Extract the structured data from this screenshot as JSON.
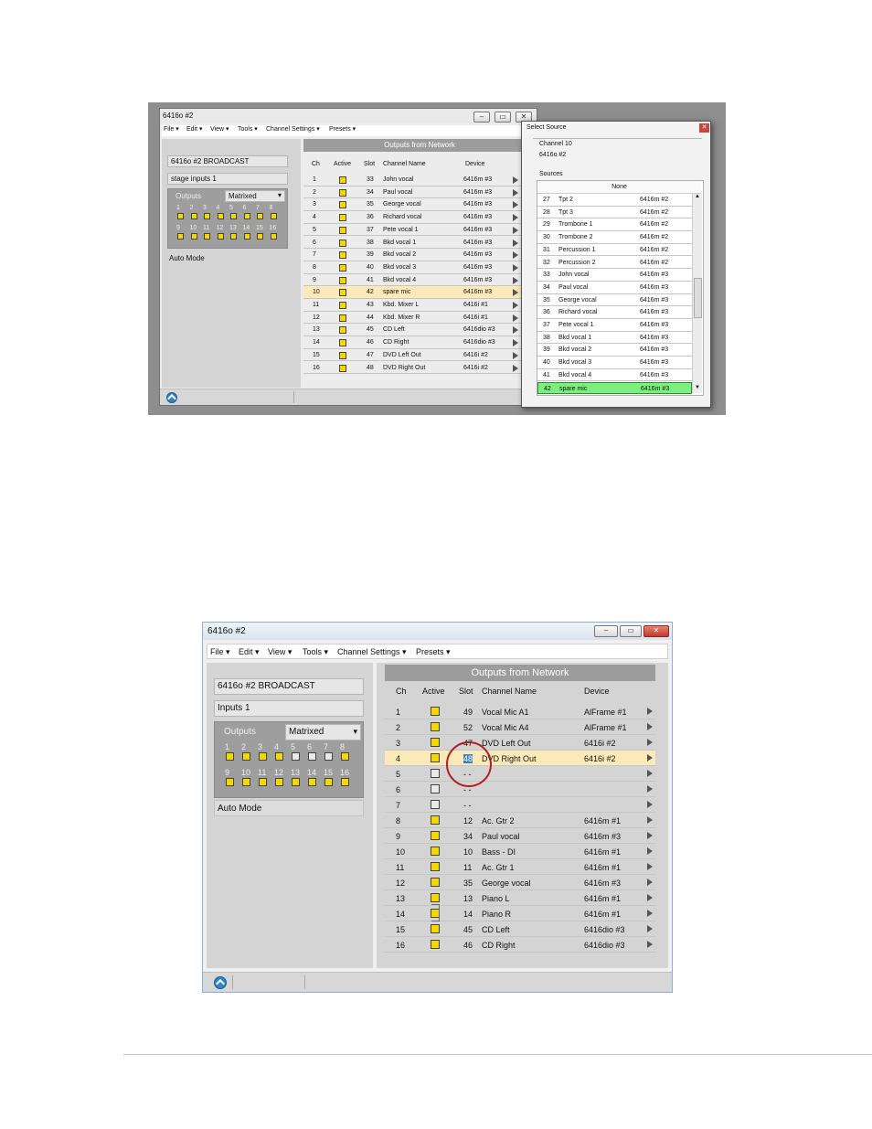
{
  "top": {
    "window_title": "6416o #2",
    "menu": [
      "File ▾",
      "Edit ▾",
      "View ▾",
      "Tools ▾",
      "Channel Settings ▾",
      "Presets ▾"
    ],
    "device_name": "6416o #2 BROADCAST",
    "inputs_name": "stage inputs 1",
    "outputs_label": "Outputs",
    "mode_select": "Matrixed",
    "grid_row1": [
      "1",
      "2",
      "3",
      "4",
      "5",
      "6",
      "7",
      "8"
    ],
    "grid_row2": [
      "9",
      "10",
      "11",
      "12",
      "13",
      "14",
      "15",
      "16"
    ],
    "grid_on1": [
      true,
      true,
      true,
      true,
      true,
      true,
      true,
      true
    ],
    "grid_on2": [
      true,
      true,
      true,
      true,
      true,
      true,
      true,
      true
    ],
    "auto_mode": "Auto Mode",
    "table_title": "Outputs from Network",
    "headers": {
      "ch": "Ch",
      "active": "Active",
      "slot": "Slot",
      "name": "Channel Name",
      "device": "Device"
    },
    "rows": [
      {
        "ch": "1",
        "slot": "33",
        "name": "John vocal",
        "device": "6416m #3"
      },
      {
        "ch": "2",
        "slot": "34",
        "name": "Paul vocal",
        "device": "6416m #3"
      },
      {
        "ch": "3",
        "slot": "35",
        "name": "George vocal",
        "device": "6416m #3"
      },
      {
        "ch": "4",
        "slot": "36",
        "name": "Richard vocal",
        "device": "6416m #3"
      },
      {
        "ch": "5",
        "slot": "37",
        "name": "Pete vocal 1",
        "device": "6416m #3"
      },
      {
        "ch": "6",
        "slot": "38",
        "name": "Bkd vocal 1",
        "device": "6416m #3"
      },
      {
        "ch": "7",
        "slot": "39",
        "name": "Bkd vocal 2",
        "device": "6416m #3"
      },
      {
        "ch": "8",
        "slot": "40",
        "name": "Bkd vocal 3",
        "device": "6416m #3"
      },
      {
        "ch": "9",
        "slot": "41",
        "name": "Bkd vocal 4",
        "device": "6416m #3"
      },
      {
        "ch": "10",
        "slot": "42",
        "name": "spare mic",
        "device": "6416m #3"
      },
      {
        "ch": "11",
        "slot": "43",
        "name": "Kbd. Mixer L",
        "device": "6416i #1"
      },
      {
        "ch": "12",
        "slot": "44",
        "name": "Kbd. Mixer R",
        "device": "6416i #1"
      },
      {
        "ch": "13",
        "slot": "45",
        "name": "CD Left",
        "device": "6416dio #3"
      },
      {
        "ch": "14",
        "slot": "46",
        "name": "CD Right",
        "device": "6416dio #3"
      },
      {
        "ch": "15",
        "slot": "47",
        "name": "DVD Left Out",
        "device": "6416i #2"
      },
      {
        "ch": "16",
        "slot": "48",
        "name": "DVD Right Out",
        "device": "6416i #2"
      }
    ],
    "popup": {
      "title": "Select Source",
      "channel_label": "Channel  10",
      "channel_device": "6416o #2",
      "sources_label": "Sources",
      "none_label": "None",
      "sources": [
        {
          "slot": "27",
          "name": "Tpt 2",
          "device": "6416m #2"
        },
        {
          "slot": "28",
          "name": "Tpt 3",
          "device": "6416m #2"
        },
        {
          "slot": "29",
          "name": "Trombone 1",
          "device": "6416m #2"
        },
        {
          "slot": "30",
          "name": "Trombone 2",
          "device": "6416m #2"
        },
        {
          "slot": "31",
          "name": "Percussion 1",
          "device": "6416m #2"
        },
        {
          "slot": "32",
          "name": "Percussion 2",
          "device": "6416m #2"
        },
        {
          "slot": "33",
          "name": "John vocal",
          "device": "6416m #3"
        },
        {
          "slot": "34",
          "name": "Paul vocal",
          "device": "6416m #3"
        },
        {
          "slot": "35",
          "name": "George vocal",
          "device": "6416m #3"
        },
        {
          "slot": "36",
          "name": "Richard vocal",
          "device": "6416m #3"
        },
        {
          "slot": "37",
          "name": "Pete vocal 1",
          "device": "6416m #3"
        },
        {
          "slot": "38",
          "name": "Bkd vocal 1",
          "device": "6416m #3"
        },
        {
          "slot": "39",
          "name": "Bkd vocal 2",
          "device": "6416m #3"
        },
        {
          "slot": "40",
          "name": "Bkd vocal 3",
          "device": "6416m #3"
        },
        {
          "slot": "41",
          "name": "Bkd vocal 4",
          "device": "6416m #3"
        },
        {
          "slot": "42",
          "name": "spare mic",
          "device": "6416m #3"
        }
      ]
    }
  },
  "bottom": {
    "window_title": "6416o #2",
    "menu": [
      "File ▾",
      "Edit ▾",
      "View ▾",
      "Tools ▾",
      "Channel Settings ▾",
      "Presets ▾"
    ],
    "device_name": "6416o #2 BROADCAST",
    "inputs_name": "Inputs 1",
    "outputs_label": "Outputs",
    "mode_select": "Matrixed",
    "grid_row1": [
      "1",
      "2",
      "3",
      "4",
      "5",
      "6",
      "7",
      "8"
    ],
    "grid_row2": [
      "9",
      "10",
      "11",
      "12",
      "13",
      "14",
      "15",
      "16"
    ],
    "grid_on1": [
      true,
      true,
      true,
      true,
      false,
      false,
      false,
      true
    ],
    "grid_on2": [
      true,
      true,
      true,
      true,
      true,
      true,
      true,
      true
    ],
    "auto_mode": "Auto Mode",
    "table_title": "Outputs from Network",
    "headers": {
      "ch": "Ch",
      "active": "Active",
      "slot": "Slot",
      "name": "Channel Name",
      "device": "Device"
    },
    "rows": [
      {
        "ch": "1",
        "slot": "49",
        "name": "Vocal Mic A1",
        "device": "AlFrame #1",
        "on": true
      },
      {
        "ch": "2",
        "slot": "52",
        "name": "Vocal Mic A4",
        "device": "AlFrame #1",
        "on": true
      },
      {
        "ch": "3",
        "slot": "47",
        "name": "DVD Left Out",
        "device": "6416i #2",
        "on": true
      },
      {
        "ch": "4",
        "slot": "48",
        "name": "DVD Right Out",
        "device": "6416i #2",
        "on": true
      },
      {
        "ch": "5",
        "slot": "- -",
        "name": "",
        "device": "",
        "on": false
      },
      {
        "ch": "6",
        "slot": "- -",
        "name": "",
        "device": "",
        "on": false
      },
      {
        "ch": "7",
        "slot": "- -",
        "name": "",
        "device": "",
        "on": false
      },
      {
        "ch": "8",
        "slot": "12",
        "name": "Ac. Gtr 2",
        "device": "6416m #1",
        "on": true
      },
      {
        "ch": "9",
        "slot": "34",
        "name": "Paul vocal",
        "device": "6416m #3",
        "on": true
      },
      {
        "ch": "10",
        "slot": "10",
        "name": "Bass - DI",
        "device": "6416m #1",
        "on": true
      },
      {
        "ch": "11",
        "slot": "11",
        "name": "Ac. Gtr 1",
        "device": "6416m #1",
        "on": true
      },
      {
        "ch": "12",
        "slot": "35",
        "name": "George vocal",
        "device": "6416m #3",
        "on": true
      },
      {
        "ch": "13",
        "slot": "13",
        "name": "Piano L",
        "device": "6416m #1",
        "on": true
      },
      {
        "ch": "14",
        "slot": "14",
        "name": "Piano R",
        "device": "6416m #1",
        "on": true
      },
      {
        "ch": "15",
        "slot": "45",
        "name": "CD Left",
        "device": "6416dio #3",
        "on": true
      },
      {
        "ch": "16",
        "slot": "46",
        "name": "CD Right",
        "device": "6416dio #3",
        "on": true
      }
    ]
  },
  "colors": {
    "accent_blue": "#3b7fd0",
    "highlight_green": "#7cf07c",
    "callout_red": "#b02020",
    "active_yellow": "#f5d800"
  }
}
